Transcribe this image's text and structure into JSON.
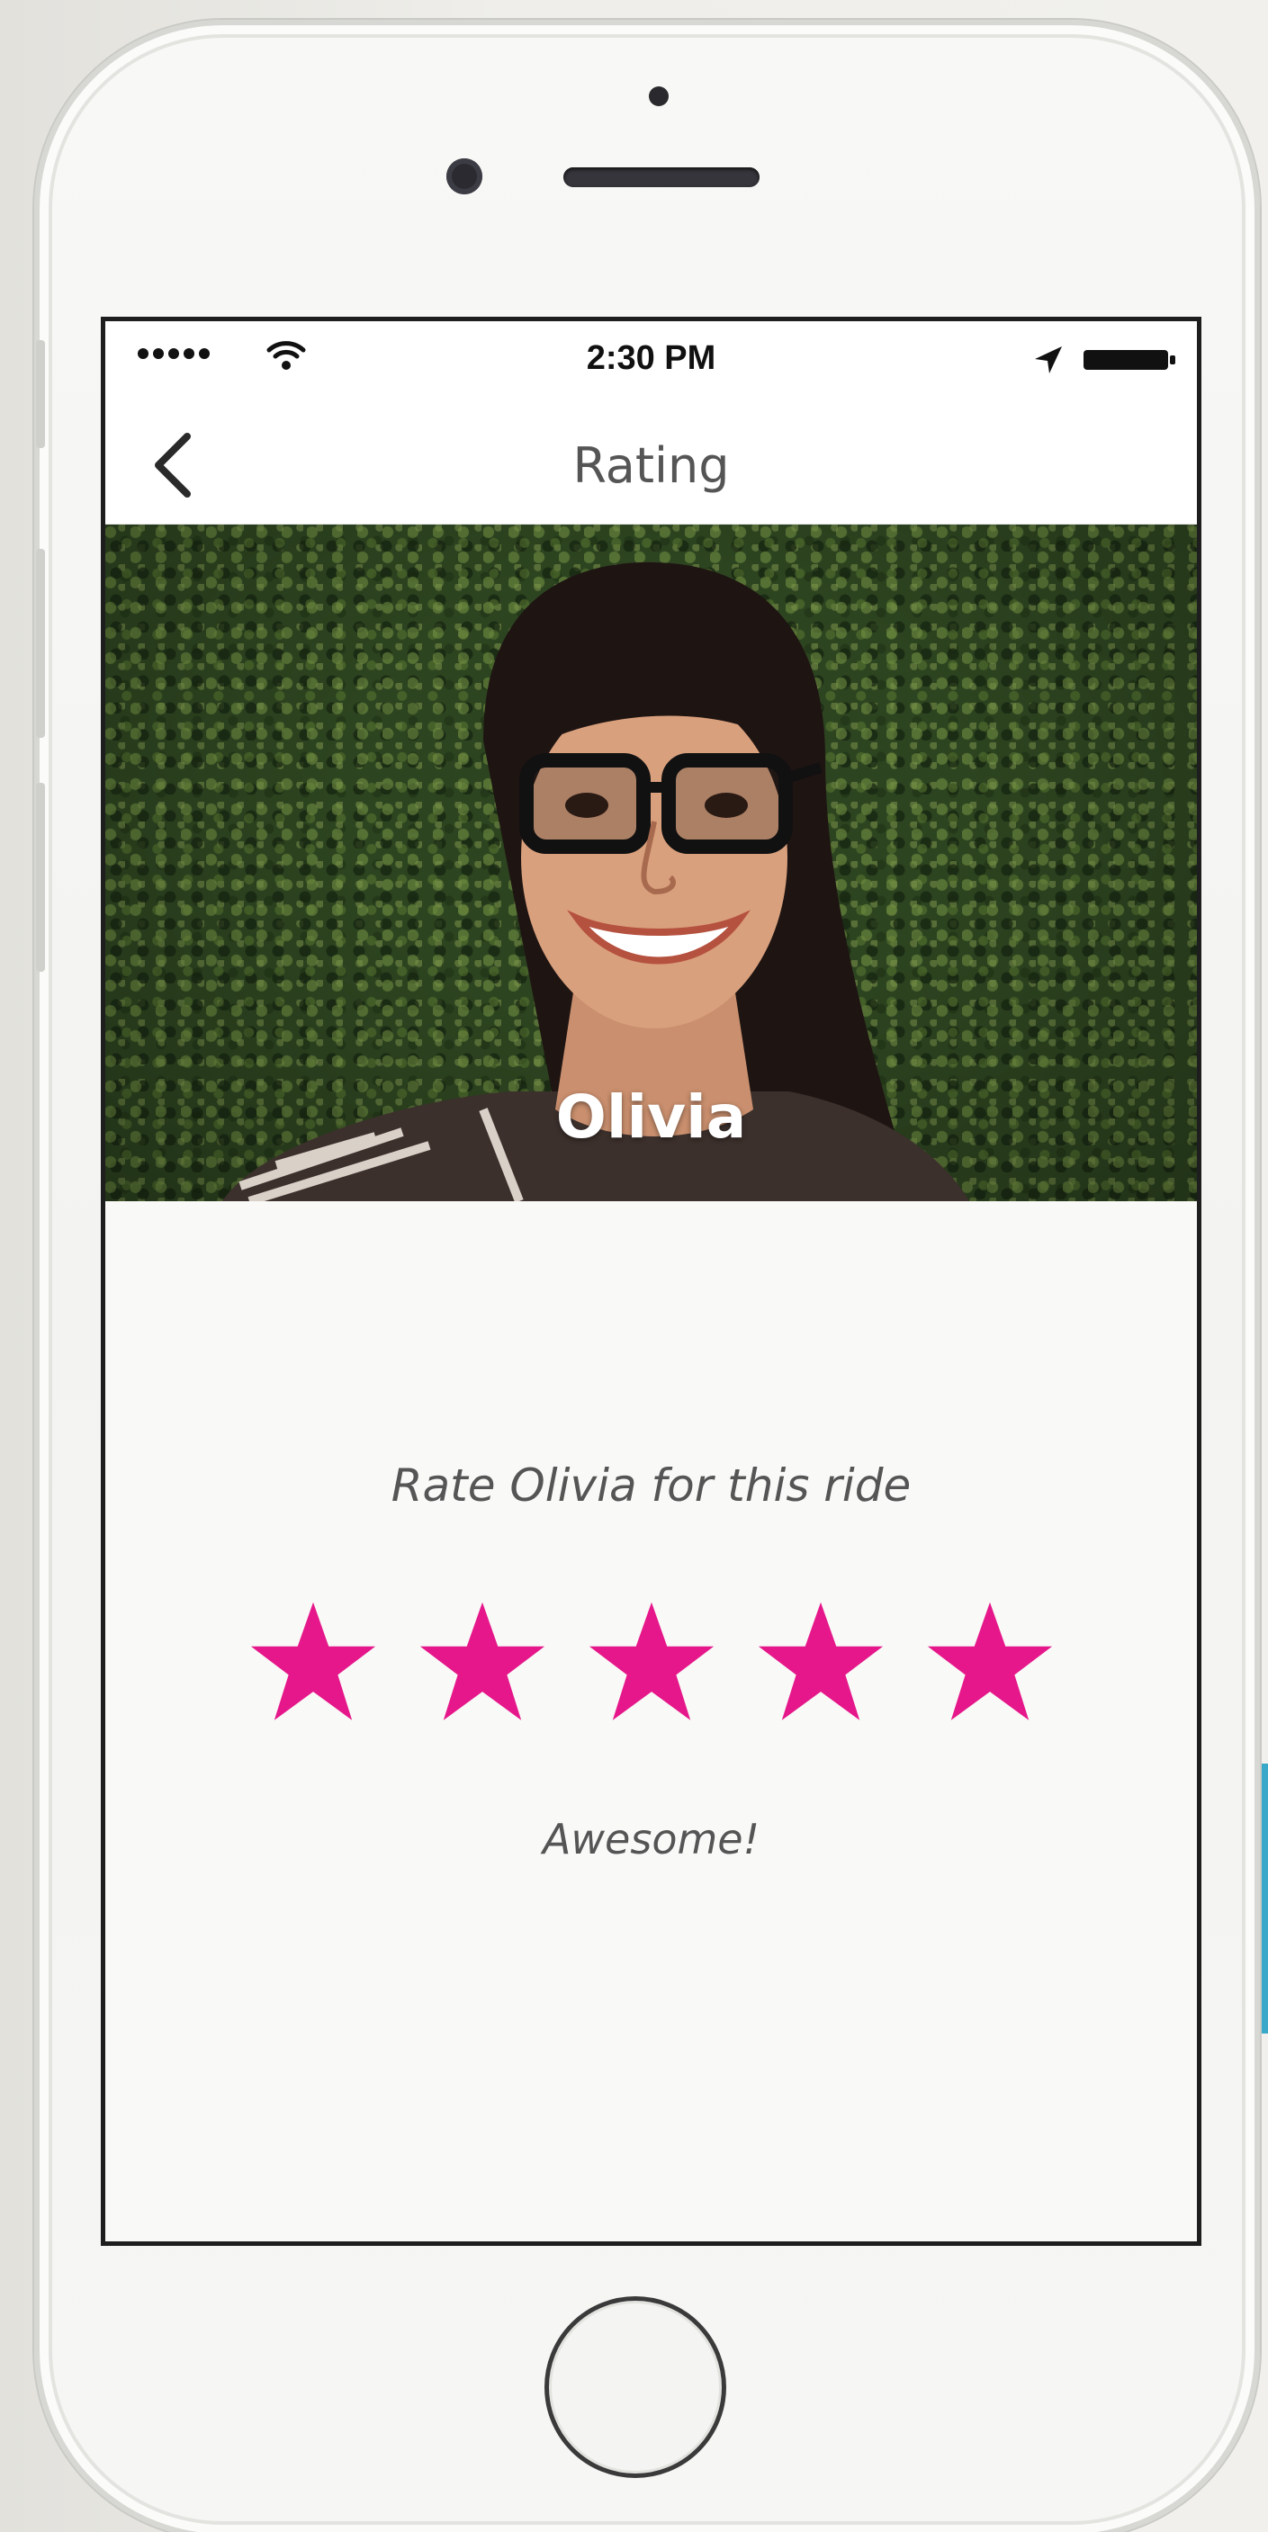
{
  "status_bar": {
    "time": "2:30 PM"
  },
  "nav": {
    "title": "Rating",
    "back_icon": "chevron-left-icon"
  },
  "driver": {
    "name": "Olivia"
  },
  "rating": {
    "prompt": "Rate Olivia for this ride",
    "stars_selected": 5,
    "stars_total": 5,
    "label": "Awesome!"
  },
  "colors": {
    "star": "#e5178a",
    "hero_background": "#2d4420",
    "text_gray": "#555555"
  }
}
